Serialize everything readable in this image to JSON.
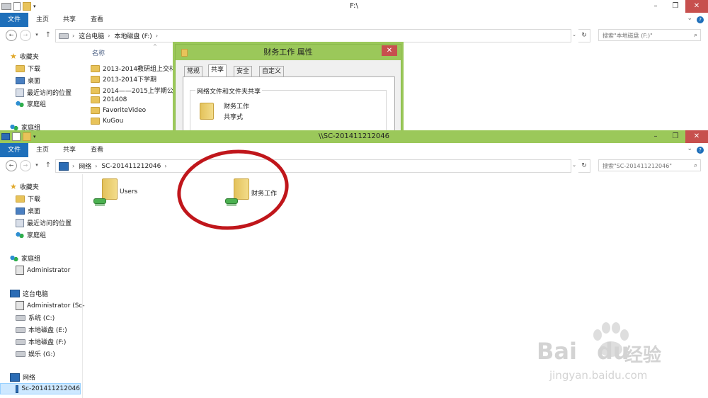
{
  "back_window": {
    "title": "F:\\",
    "ribbon": {
      "file": "文件",
      "home": "主页",
      "share": "共享",
      "view": "查看"
    },
    "address": {
      "this_pc": "这台电脑",
      "drive": "本地磁盘 (F:)"
    },
    "search_placeholder": "搜索\"本地磁盘 (F:)\"",
    "nav": {
      "favorites": "收藏夹",
      "downloads": "下载",
      "desktop": "桌面",
      "recent": "最近访问的位置",
      "homegroup": "家庭组",
      "homegroup2": "家庭组"
    },
    "column_name": "名称",
    "files": [
      "2013-2014教研组上交材料",
      "2013-2014下学期",
      "2014——2015上学期公开",
      "201408",
      "FavoriteVideo",
      "KuGou"
    ]
  },
  "dialog": {
    "title": "财务工作 属性",
    "close": "✕",
    "tabs": [
      "常规",
      "共享",
      "安全",
      "自定义"
    ],
    "group_title": "网络文件和文件夹共享",
    "folder_name": "财务工作",
    "folder_status": "共享式"
  },
  "front_window": {
    "title": "\\\\SC-201411212046",
    "ribbon": {
      "file": "文件",
      "home": "主页",
      "share": "共享",
      "view": "查看"
    },
    "address": {
      "network": "网络",
      "host": "SC-201411212046"
    },
    "search_placeholder": "搜索\"SC-201411212046\"",
    "nav": {
      "favorites": "收藏夹",
      "downloads": "下载",
      "desktop": "桌面",
      "recent": "最近访问的位置",
      "homegroup": "家庭组",
      "homegroup_section": "家庭组",
      "administrator": "Administrator",
      "this_pc": "这台电脑",
      "admin_pc": "Administrator (Sc-",
      "drive_c": "系统 (C:)",
      "drive_e": "本地磁盘 (E:)",
      "drive_f": "本地磁盘 (F:)",
      "drive_g": "娱乐 (G:)",
      "network": "网络",
      "host": "Sc-201411212046"
    },
    "items": [
      "Users",
      "财务工作"
    ]
  },
  "watermark": {
    "brand": "Bai",
    "brand2": "du",
    "cn": "经验",
    "url": "jingyan.baidu.com"
  },
  "colors": {
    "accent_green": "#9bc85a",
    "file_tab_blue": "#1e6fba",
    "annotation_red": "#c0161b"
  }
}
